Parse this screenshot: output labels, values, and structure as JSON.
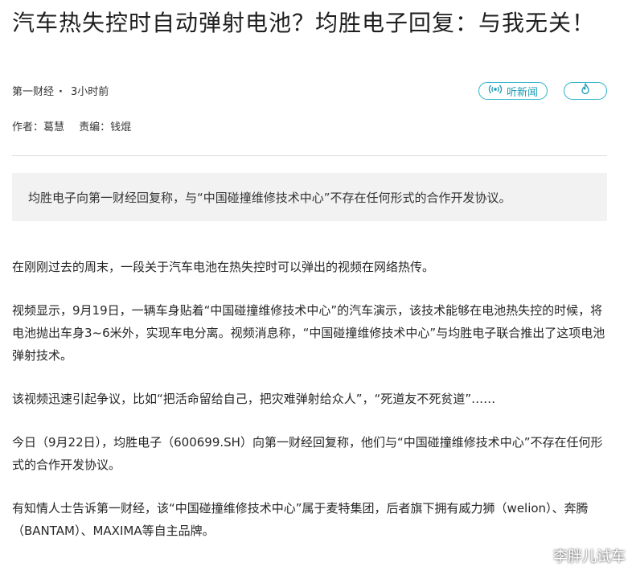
{
  "article": {
    "title": "汽车热失控时自动弹射电池？均胜电子回复：与我无关！",
    "source": "第一财经",
    "time": "3小时前",
    "listen_label": "听新闻",
    "author": "作者：葛慧",
    "editor": "责编：钱焜",
    "summary": "均胜电子向第一财经回复称，与“中国碰撞维修技术中心”不存在任何形式的合作开发协议。",
    "paragraphs": [
      "在刚刚过去的周末，一段关于汽车电池在热失控时可以弹出的视频在网络热传。",
      "视频显示，9月19日，一辆车身贴着“中国碰撞维修技术中心”的汽车演示，该技术能够在电池热失控的时候，将电池抛出车身3~6米外，实现车电分离。视频消息称，“中国碰撞维修技术中心”与均胜电子联合推出了这项电池弹射技术。",
      "该视频迅速引起争议，比如“把活命留给自己，把灾难弹射给众人”，“死道友不死贫道”……",
      "今日（9月22日），均胜电子（600699.SH）向第一财经回复称，他们与“中国碰撞维修技术中心”不存在任何形式的合作开发协议。",
      "有知情人士告诉第一财经，该“中国碰撞维修技术中心”属于麦特集团，后者旗下拥有威力狮（welion）、奔腾（BANTAM）、MAXIMA等自主品牌。"
    ]
  },
  "icons": {
    "listen": "radio-wave-icon",
    "fire": "flame-icon"
  },
  "watermark": {
    "text": "李胖儿试车"
  },
  "colors": {
    "accent": "#1a9bb5",
    "summary_bg": "#f2f2f2",
    "divider": "#e2e2e2"
  }
}
